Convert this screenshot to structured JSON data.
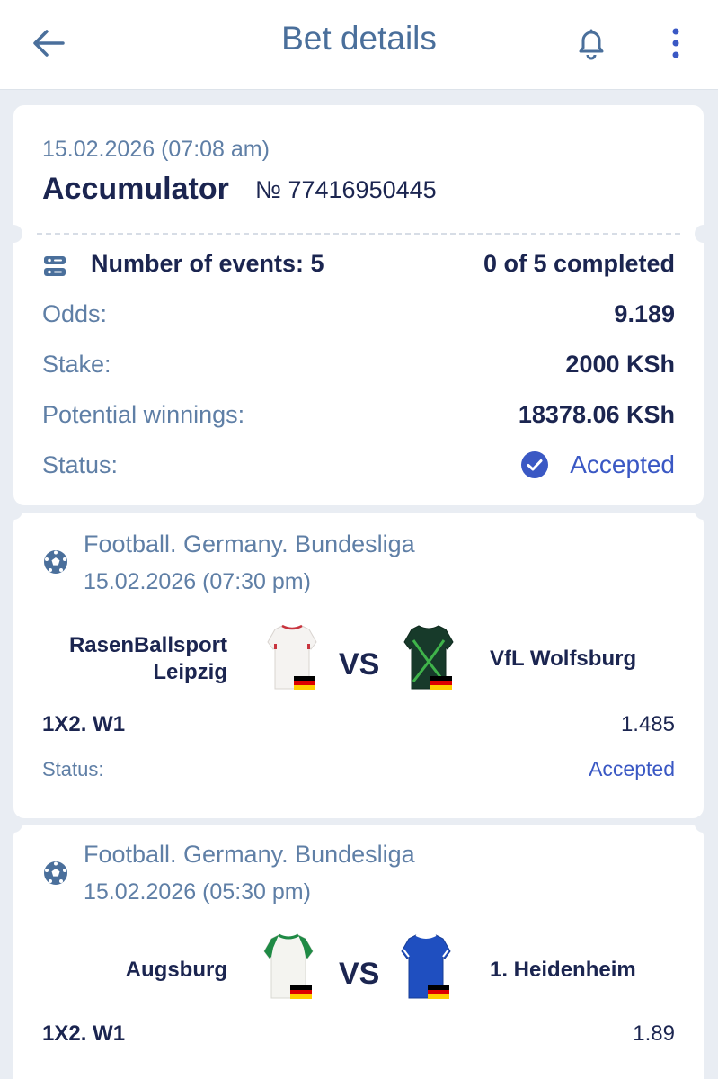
{
  "header": {
    "title": "Bet details"
  },
  "bet": {
    "date": "15.02.2026 (07:08 am)",
    "type": "Accumulator",
    "number": "№ 77416950445",
    "events_label": "Number of events: 5",
    "completed": "0 of 5 completed",
    "rows": [
      {
        "label": "Odds:",
        "value": "9.189"
      },
      {
        "label": "Stake:",
        "value": "2000 KSh"
      },
      {
        "label": "Potential winnings:",
        "value": "18378.06 KSh"
      }
    ],
    "status_label": "Status:",
    "status_value": "Accepted"
  },
  "events": [
    {
      "league": "Football. Germany. Bundesliga",
      "date": "15.02.2026 (07:30 pm)",
      "home_line1": "RasenBallsport",
      "home_line2": "Leipzig",
      "away": "VfL Wolfsburg",
      "vs": "VS",
      "market": "1X2. W1",
      "odds": "1.485",
      "status_label": "Status:",
      "status_value": "Accepted"
    },
    {
      "league": "Football. Germany. Bundesliga",
      "date": "15.02.2026 (05:30 pm)",
      "home_line1": "Augsburg",
      "away": "1. Heidenheim",
      "vs": "VS",
      "market": "1X2. W1",
      "odds": "1.89"
    }
  ],
  "icons": [
    "back-arrow-icon",
    "bell-icon",
    "more-vertical-icon",
    "events-list-icon",
    "check-circle-icon",
    "football-icon",
    "jersey-icon",
    "germany-flag-icon"
  ],
  "colors": {
    "accent": "#3a58c4",
    "title": "#4a6f9b",
    "dark_text": "#1b2550",
    "muted_text": "#5f7fa6",
    "background": "#e9edf3"
  }
}
